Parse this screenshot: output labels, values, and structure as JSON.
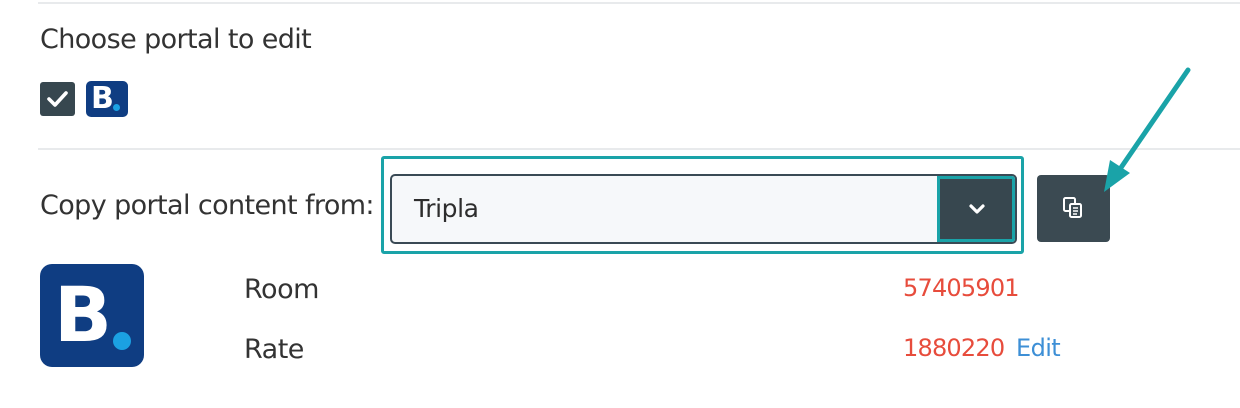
{
  "choose_portal": {
    "title": "Choose portal to edit",
    "checkbox_checked": true,
    "portal_logo_letter": "B"
  },
  "copy": {
    "label": "Copy portal content from:",
    "selected": "Tripla",
    "toggle_icon": "chevron-down-icon",
    "button_icon": "copy-icon"
  },
  "mapping": {
    "logo_letter": "B",
    "room_label": "Room",
    "room_id": "57405901",
    "rate_label": "Rate",
    "rate_id": "1880220",
    "edit_label": "Edit"
  },
  "colors": {
    "accent": "#1aa3a8",
    "dark": "#37474f",
    "brand": "#0f3d82",
    "brand_dot": "#1ba1e2",
    "id_red": "#e74c3c",
    "link_blue": "#3d8fd6"
  }
}
